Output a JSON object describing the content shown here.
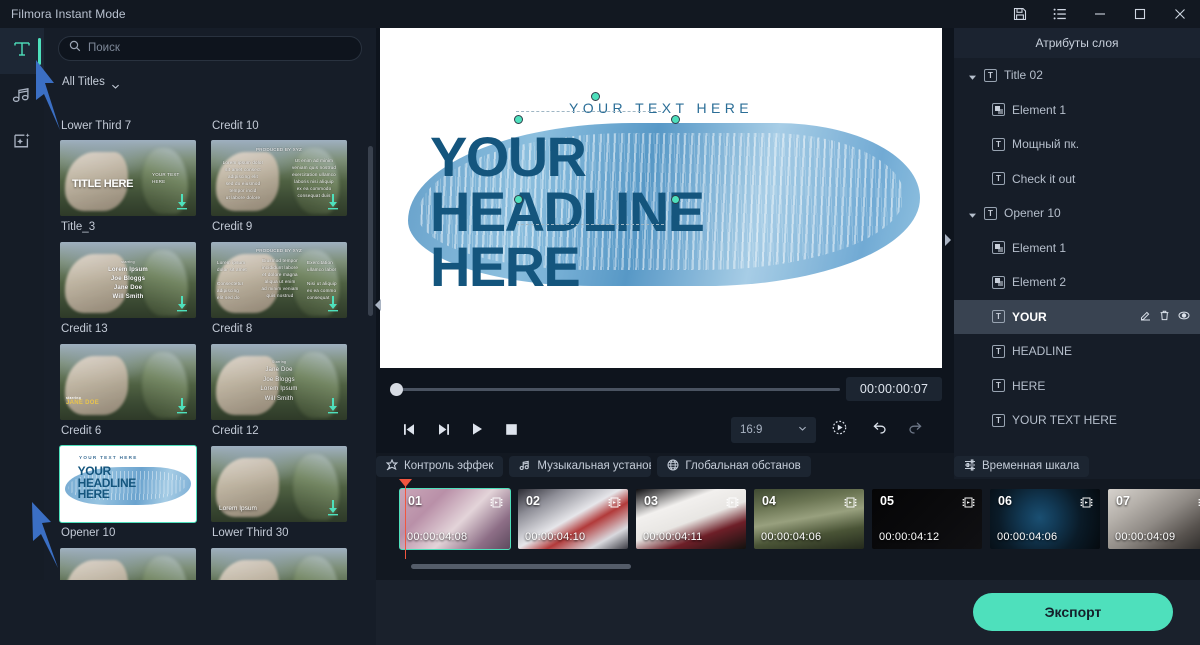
{
  "window": {
    "title": "Filmora Instant Mode",
    "controls": [
      {
        "name": "save-icon",
        "label": "Save"
      },
      {
        "name": "list-icon",
        "label": "List"
      },
      {
        "name": "minimize-icon",
        "label": "Minimize"
      },
      {
        "name": "maximize-icon",
        "label": "Maximize"
      },
      {
        "name": "close-icon",
        "label": "Close"
      }
    ]
  },
  "rail": {
    "items": [
      {
        "name": "titles",
        "icon": "text-t-icon",
        "active": true
      },
      {
        "name": "audio",
        "icon": "music-note-icon",
        "active": false
      },
      {
        "name": "effects",
        "icon": "effects-sparkle-icon",
        "active": false
      }
    ]
  },
  "library": {
    "search": {
      "placeholder": "Поиск",
      "value": ""
    },
    "filter": {
      "label": "All Titles"
    },
    "top_captions": [
      "Lower Third 7",
      "Credit 10"
    ],
    "items": [
      {
        "caption": "Title_3",
        "style": "vine-title",
        "selected": false
      },
      {
        "caption": "Credit 9",
        "style": "vine-credits",
        "selected": false
      },
      {
        "caption": "Credit 13",
        "style": "vine-names",
        "selected": false
      },
      {
        "caption": "Credit 8",
        "style": "vine-credits",
        "selected": false
      },
      {
        "caption": "Credit 6",
        "style": "vine-janedoe",
        "selected": false
      },
      {
        "caption": "Credit 12",
        "style": "vine-cast",
        "selected": false
      },
      {
        "caption": "Opener 10",
        "style": "opener",
        "selected": true
      },
      {
        "caption": "Lower Third 30",
        "style": "vine-lorem",
        "selected": false
      }
    ],
    "thumb_texts": {
      "title_here": "TITLE HERE",
      "title_sub": "YOUR TEXT HERE",
      "names": [
        "Lorem Ipsum",
        "Joe Bloggs",
        "Jane Doe",
        "Will Smith"
      ],
      "cast": [
        "Jane Doe",
        "Joe Bloggs",
        "Lorem Ipsum",
        "Will Smith"
      ],
      "cast_label": "Starring",
      "jane_doe": "JANE DOE",
      "jane_doe_sub": "starring",
      "lorem": "Lorem Ipsum",
      "credits_header": "PRODUCED BY XYZ",
      "opener_sub": "YOUR TEXT HERE",
      "opener_head": "YOUR\nHEADLINE\nHERE"
    }
  },
  "preview": {
    "subtitle": "YOUR TEXT HERE",
    "headline_lines": [
      "YOUR",
      "HEADLINE",
      "HERE"
    ],
    "timecode": "00:00:00:07",
    "aspect_ratio": "16:9",
    "controls": [
      {
        "name": "prev-frame-button",
        "icon": "step-back-icon"
      },
      {
        "name": "next-frame-button",
        "icon": "step-forward-icon"
      },
      {
        "name": "play-button",
        "icon": "play-icon"
      },
      {
        "name": "stop-button",
        "icon": "stop-icon"
      }
    ],
    "right_controls": [
      {
        "name": "snapshot-button",
        "icon": "snapshot-icon"
      },
      {
        "name": "undo-button",
        "icon": "undo-icon"
      },
      {
        "name": "redo-button",
        "icon": "redo-icon"
      }
    ]
  },
  "layers": {
    "title": "Атрибуты слоя",
    "rows": [
      {
        "label": "Title 02",
        "icon": "text-badge-icon",
        "level": 0,
        "expanded": true,
        "selected": false
      },
      {
        "label": "Element 1",
        "icon": "element-badge-icon",
        "level": 1,
        "expanded": null,
        "selected": false
      },
      {
        "label": "Мощный пк.",
        "icon": "text-badge-icon",
        "level": 1,
        "expanded": null,
        "selected": false
      },
      {
        "label": "Check it out",
        "icon": "text-badge-icon",
        "level": 1,
        "expanded": null,
        "selected": false
      },
      {
        "label": "Opener 10",
        "icon": "text-badge-icon",
        "level": 0,
        "expanded": true,
        "selected": false
      },
      {
        "label": "Element 1",
        "icon": "element-badge-icon",
        "level": 1,
        "expanded": null,
        "selected": false
      },
      {
        "label": "Element 2",
        "icon": "element-badge-icon",
        "level": 1,
        "expanded": null,
        "selected": false
      },
      {
        "label": "YOUR",
        "icon": "text-badge-icon",
        "level": 1,
        "expanded": null,
        "selected": true
      },
      {
        "label": "HEADLINE",
        "icon": "text-badge-icon",
        "level": 1,
        "expanded": null,
        "selected": false
      },
      {
        "label": "HERE",
        "icon": "text-badge-icon",
        "level": 1,
        "expanded": null,
        "selected": false
      },
      {
        "label": "YOUR TEXT HERE",
        "icon": "text-badge-icon",
        "level": 1,
        "expanded": null,
        "selected": false
      }
    ],
    "row_actions": [
      {
        "name": "edit-layer-icon"
      },
      {
        "name": "delete-layer-icon"
      },
      {
        "name": "visibility-layer-icon"
      }
    ]
  },
  "timeline_tabs": [
    {
      "label": "Контроль эффек",
      "icon": "effect-control-icon"
    },
    {
      "label": "Музыкальная установк",
      "icon": "music-settings-icon"
    },
    {
      "label": "Глобальная обстанов",
      "icon": "globe-icon"
    }
  ],
  "timeline_tabs_right": [
    {
      "label": "Временная шкала",
      "icon": "timeline-icon"
    }
  ],
  "timeline": {
    "clips": [
      {
        "no": "01",
        "duration": "00:00:04:08",
        "selected": true,
        "icon": "filmstrip-icon"
      },
      {
        "no": "02",
        "duration": "00:00:04:10",
        "selected": false,
        "icon": "filmstrip-icon"
      },
      {
        "no": "03",
        "duration": "00:00:04:11",
        "selected": false,
        "icon": "filmstrip-icon"
      },
      {
        "no": "04",
        "duration": "00:00:04:06",
        "selected": false,
        "icon": "filmstrip-icon"
      },
      {
        "no": "05",
        "duration": "00:00:04:12",
        "selected": false,
        "icon": "filmstrip-icon"
      },
      {
        "no": "06",
        "duration": "00:00:04:06",
        "selected": false,
        "icon": "filmstrip-icon"
      },
      {
        "no": "07",
        "duration": "00:00:04:09",
        "selected": false,
        "icon": "filmstrip-icon"
      }
    ]
  },
  "bottom": {
    "export_label": "Экспорт"
  },
  "colors": {
    "accent": "#4ee0bc",
    "panel_bg": "#161d28",
    "window_bg": "#121821",
    "playhead": "#f1553f",
    "brand_blue": "#14557d",
    "annotation_arrow": "#3b6fc4"
  }
}
